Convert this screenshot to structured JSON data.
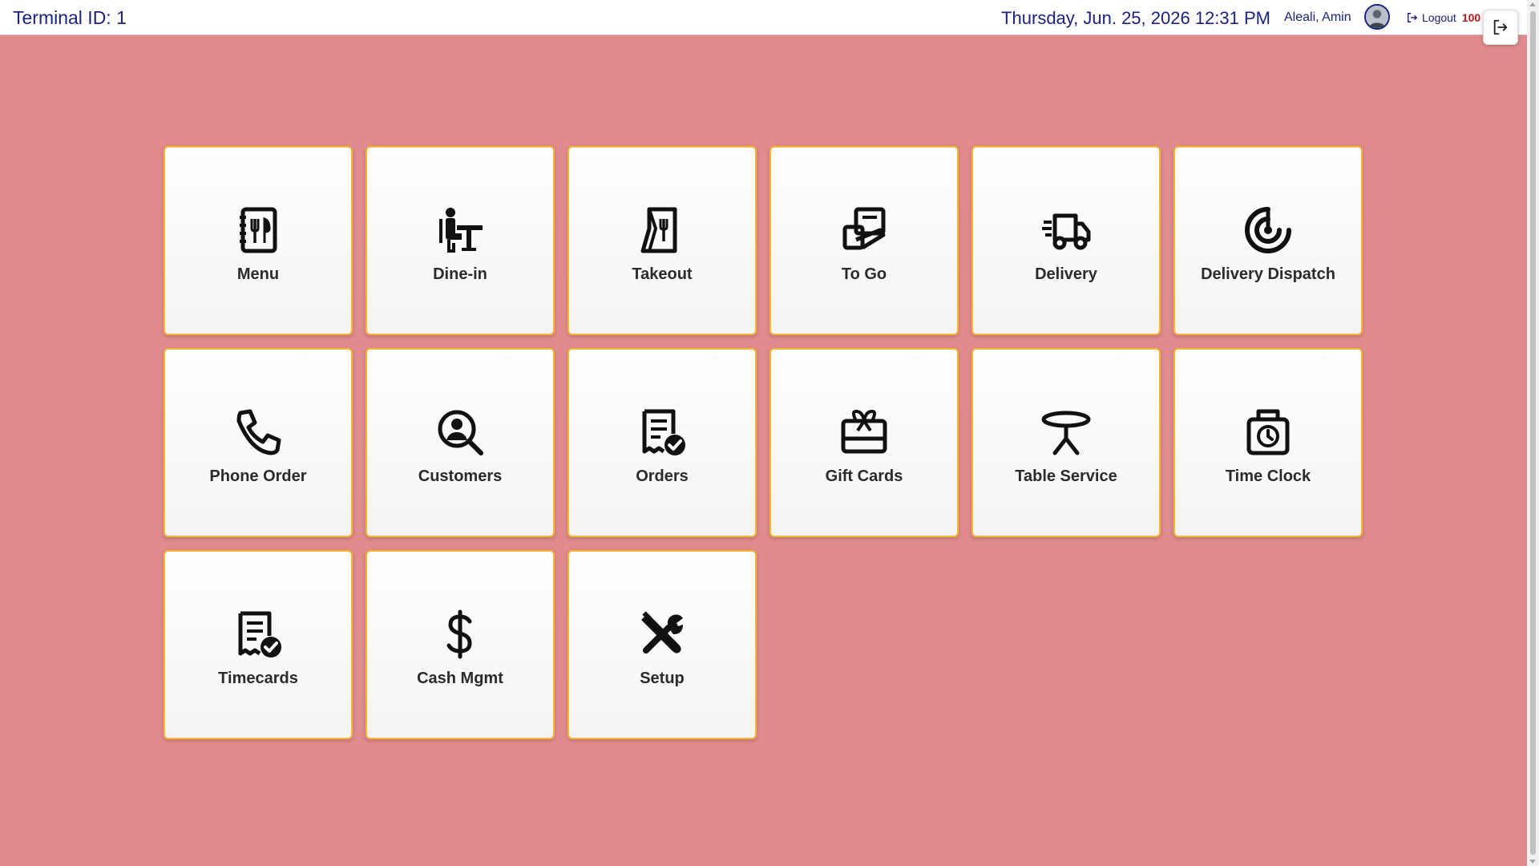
{
  "header": {
    "terminal_id": "Terminal ID: 1",
    "datetime": "Thursday, Jun. 25, 2026 12:31 PM",
    "user_name": "Aleali, Amin",
    "logout_label": "Logout",
    "logout_code": "100"
  },
  "tiles": [
    {
      "label": "Menu",
      "icon": "menu-book-icon"
    },
    {
      "label": "Dine-in",
      "icon": "dine-in-icon"
    },
    {
      "label": "Takeout",
      "icon": "takeout-bag-icon"
    },
    {
      "label": "To Go",
      "icon": "to-go-icon"
    },
    {
      "label": "Delivery",
      "icon": "delivery-truck-icon"
    },
    {
      "label": "Delivery Dispatch",
      "icon": "dispatch-radar-icon"
    },
    {
      "label": "Phone Order",
      "icon": "phone-icon"
    },
    {
      "label": "Customers",
      "icon": "customer-search-icon"
    },
    {
      "label": "Orders",
      "icon": "orders-receipt-icon"
    },
    {
      "label": "Gift Cards",
      "icon": "gift-card-icon"
    },
    {
      "label": "Table Service",
      "icon": "table-icon"
    },
    {
      "label": "Time Clock",
      "icon": "time-clock-icon"
    },
    {
      "label": "Timecards",
      "icon": "timecards-icon"
    },
    {
      "label": "Cash Mgmt",
      "icon": "dollar-icon"
    },
    {
      "label": "Setup",
      "icon": "tools-icon"
    }
  ],
  "colors": {
    "background": "#e08b8c",
    "tile_border": "#f5b731",
    "header_text": "#1a237e",
    "logout_code": "#b71c1c"
  }
}
